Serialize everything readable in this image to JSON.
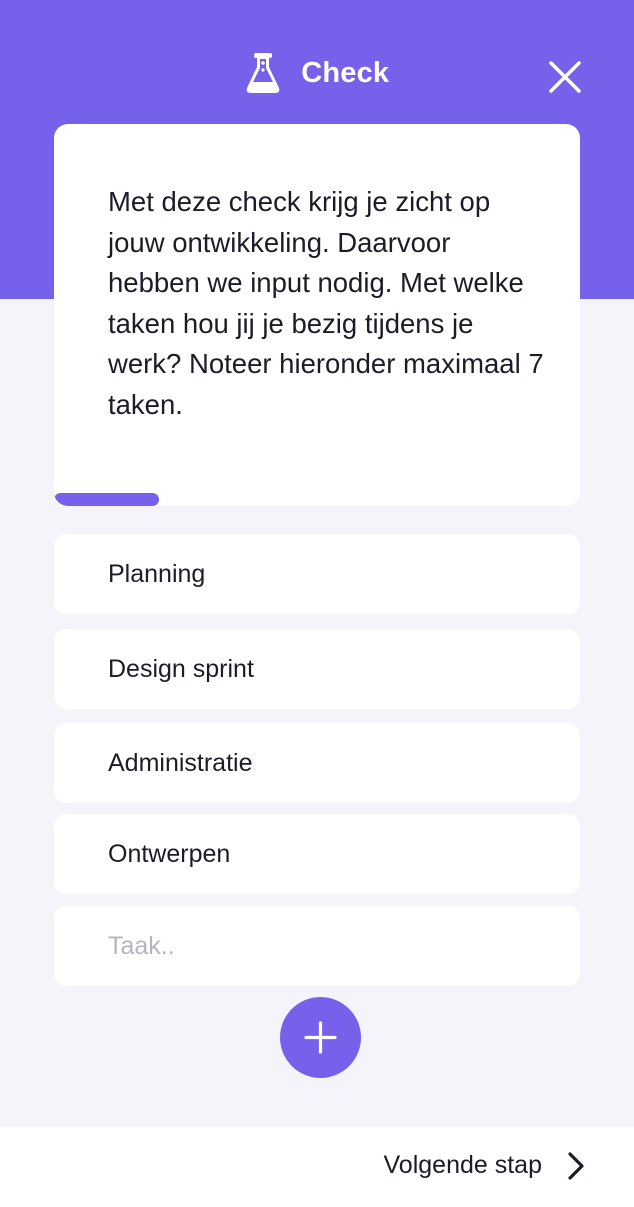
{
  "header": {
    "title": "Check",
    "icon": "flask-icon",
    "close_icon": "close-icon",
    "background": "#7662ea"
  },
  "intro": {
    "text": "Met deze check krijg je zicht op jouw ontwikkeling. Daarvoor hebben we input nodig. Met welke taken hou jij je bezig tijdens je werk? Noteer hieronder maximaal 7 taken.",
    "progress": 0.2
  },
  "tasks": [
    "Planning",
    "Design sprint",
    "Administratie",
    "Ontwerpen"
  ],
  "new_task": {
    "value": "",
    "placeholder": "Taak.."
  },
  "add_button": {
    "icon": "plus-icon"
  },
  "footer": {
    "next_label": "Volgende stap",
    "next_icon": "chevron-right-icon"
  }
}
